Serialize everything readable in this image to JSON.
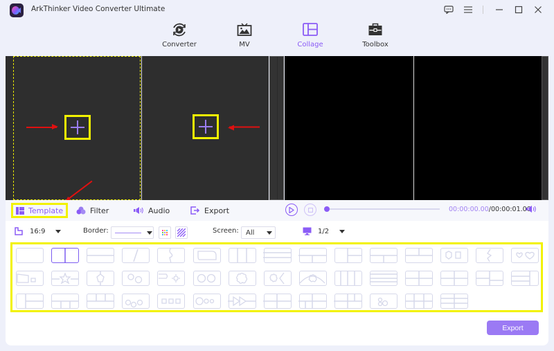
{
  "app": {
    "title": "ArkThinker Video Converter Ultimate",
    "window_controls": [
      "feedback-icon",
      "menu-icon",
      "minimize-icon",
      "maximize-icon",
      "close-icon"
    ]
  },
  "nav": {
    "items": [
      {
        "label": "Converter",
        "icon": "converter-icon",
        "active": false
      },
      {
        "label": "MV",
        "icon": "mv-icon",
        "active": false
      },
      {
        "label": "Collage",
        "icon": "collage-icon",
        "active": true
      },
      {
        "label": "Toolbox",
        "icon": "toolbox-icon",
        "active": false
      }
    ]
  },
  "tabs": {
    "template": "Template",
    "filter": "Filter",
    "audio": "Audio",
    "export": "Export"
  },
  "player": {
    "current_time": "00:00:00.00",
    "total_time": "/00:00:01.00",
    "progress": 0
  },
  "options": {
    "aspect_ratio": "16:9",
    "border_label": "Border:",
    "screen_label": "Screen:",
    "screen_value": "All",
    "page": "1/2"
  },
  "templates": {
    "count": 43,
    "selected_index": 1
  },
  "export_button": "Export",
  "colors": {
    "accent": "#8b5cf6",
    "highlight": "#f2f200",
    "annotation_arrow": "#e01010"
  }
}
